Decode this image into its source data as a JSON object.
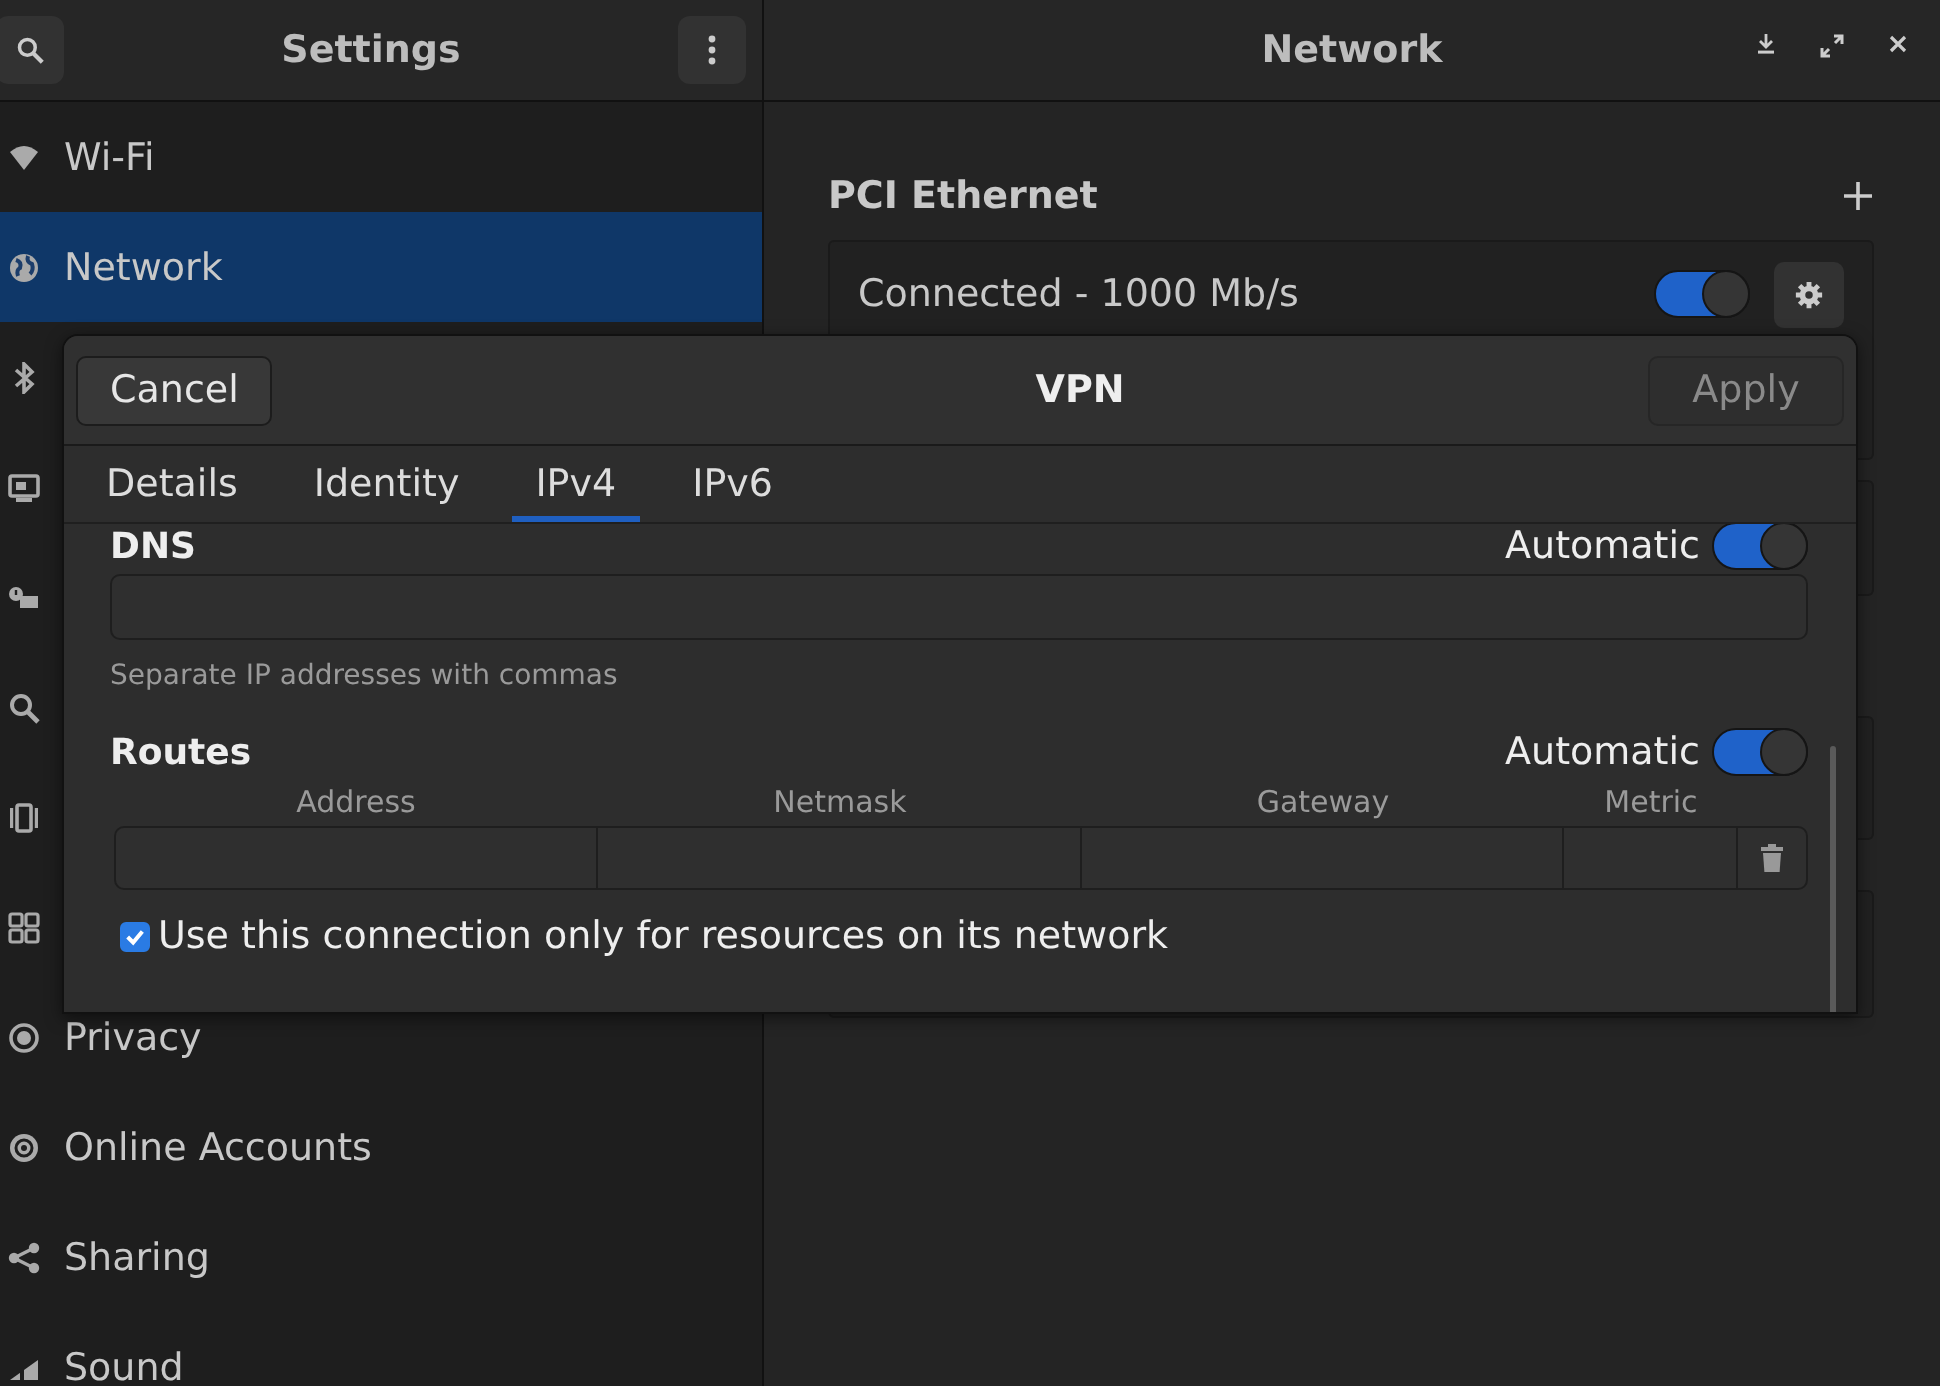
{
  "window": {
    "sidebar_title": "Settings",
    "pane_title": "Network"
  },
  "sidebar": {
    "items": [
      {
        "label": "Wi-Fi",
        "selected": false
      },
      {
        "label": "Network",
        "selected": true
      },
      {
        "selected": false
      },
      {
        "selected": false
      },
      {
        "selected": false
      },
      {
        "selected": false
      },
      {
        "selected": false
      },
      {
        "selected": false
      },
      {
        "label": "Privacy",
        "selected": false
      },
      {
        "label": "Online Accounts",
        "selected": false
      },
      {
        "label": "Sharing",
        "selected": false
      },
      {
        "label": "Sound",
        "selected": false
      }
    ]
  },
  "network": {
    "section_title": "PCI Ethernet",
    "connection": {
      "status": "Connected - 1000 Mb/s",
      "on": true
    }
  },
  "dialog": {
    "title": "VPN",
    "cancel": "Cancel",
    "apply": {
      "label": "Apply",
      "disabled": true
    },
    "tabs": [
      {
        "label": "Details",
        "selected": false
      },
      {
        "label": "Identity",
        "selected": false
      },
      {
        "label": "IPv4",
        "selected": true
      },
      {
        "label": "IPv6",
        "selected": false
      }
    ],
    "dns": {
      "label": "DNS",
      "automatic_label": "Automatic",
      "automatic": true,
      "hint": "Separate IP addresses with commas"
    },
    "routes": {
      "label": "Routes",
      "automatic_label": "Automatic",
      "automatic": true,
      "columns": [
        "Address",
        "Netmask",
        "Gateway",
        "Metric"
      ]
    },
    "only_local": {
      "label": "Use this connection only for resources on its network",
      "checked": true
    }
  }
}
